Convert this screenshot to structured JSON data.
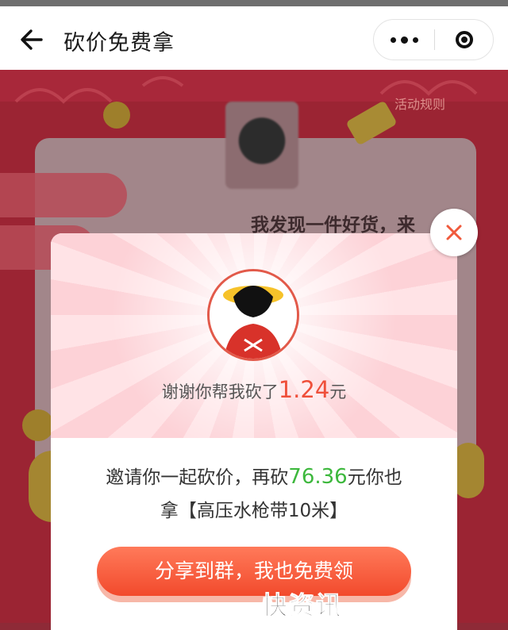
{
  "navbar": {
    "back_icon": "arrow-left-icon",
    "title": "砍价免费拿",
    "more_icon": "more-dots-icon",
    "close_icon": "target-close-icon"
  },
  "background_page": {
    "rules_link": "活动规则",
    "share_text": "我发现一件好货，来"
  },
  "popup": {
    "thanks_prefix": "谢谢你帮我砍了",
    "thanks_amount": "1.24",
    "thanks_suffix": "元",
    "invite_prefix": "邀请你一起砍价，再砍",
    "invite_amount": "76.36",
    "invite_suffix": "元你也",
    "invite_line2": "拿【高压水枪带10米】",
    "cta_label": "分享到群，我也免费领",
    "close_icon": "close-x-icon"
  },
  "watermark": "快资讯",
  "colors": {
    "accent_red": "#ef4f3a",
    "amount_green": "#3db83d",
    "cta_orange": "#f24a2c",
    "dim_background": "#9b2433"
  }
}
